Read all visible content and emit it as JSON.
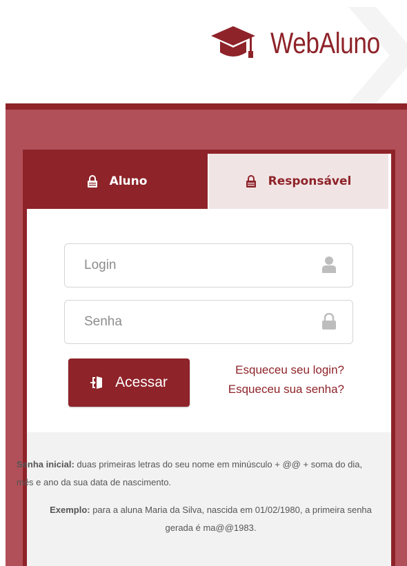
{
  "header": {
    "brand_name": "WebAluno",
    "brand_icon": "graduation-cap-icon",
    "brand_color": "#8e2329"
  },
  "tabs": [
    {
      "label": "Aluno",
      "icon": "lock-icon",
      "active": true
    },
    {
      "label": "Responsável",
      "icon": "lock-icon",
      "active": false
    }
  ],
  "form": {
    "login_placeholder": "Login",
    "login_value": "",
    "login_icon": "user-icon",
    "password_placeholder": "Senha",
    "password_value": "",
    "password_icon": "lock-icon",
    "submit_label": "Acessar",
    "submit_icon": "sign-in-icon",
    "forgot_login": "Esqueceu seu login?",
    "forgot_password": "Esqueceu sua senha?"
  },
  "info": {
    "initial_label": "Senha inicial:",
    "initial_text": " duas primeiras letras do seu nome em minúsculo + @@ + soma do dia, mês e ano da sua data de nascimento.",
    "example_label": "Exemplo:",
    "example_text": " para a aluna Maria da Silva, nascida em 01/02/1980, a primeira senha gerada é ma@@1983."
  },
  "colors": {
    "primary": "#8e2329",
    "band": "#b15059",
    "tab_inactive_bg": "#f1e4e5",
    "info_bg": "#f2f2f2"
  }
}
